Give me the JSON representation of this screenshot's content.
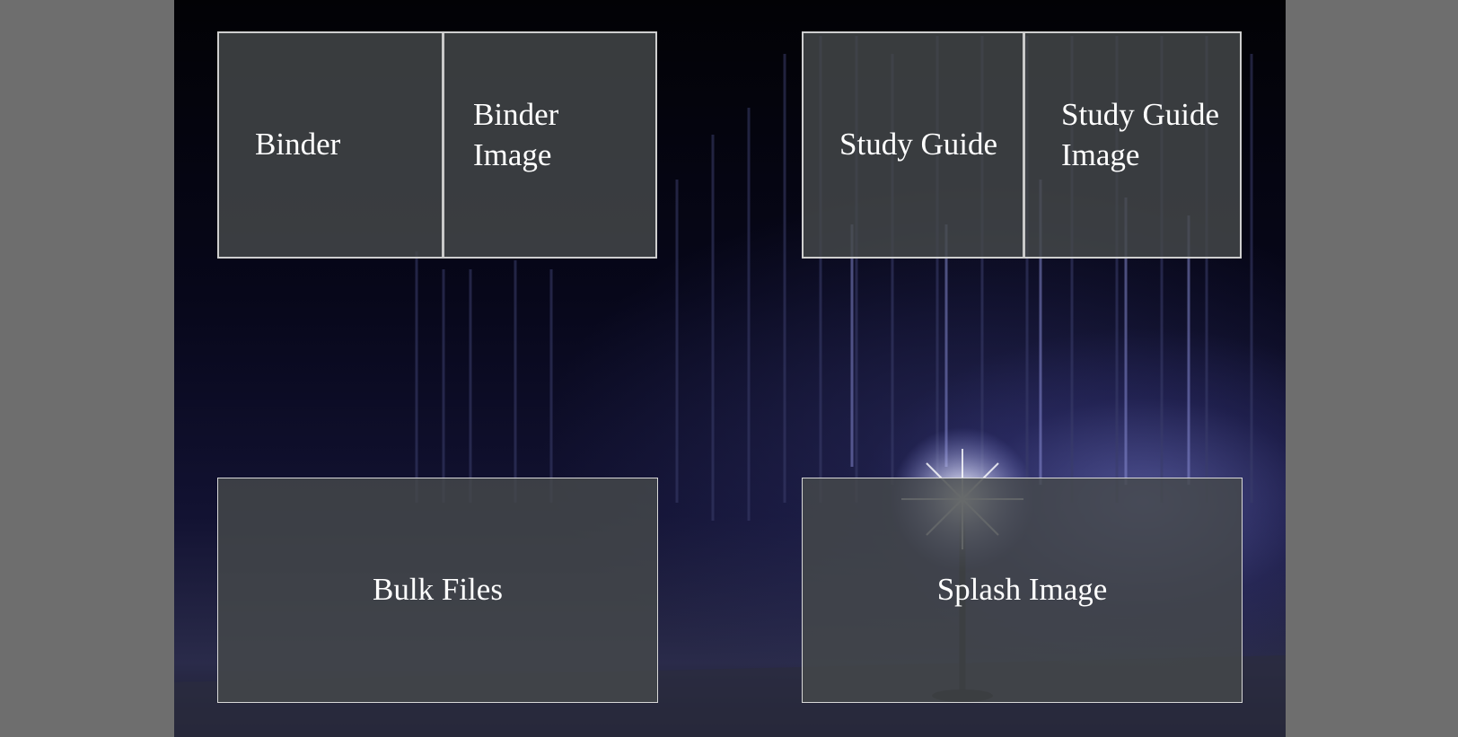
{
  "tiles": {
    "binder": "Binder",
    "binder_image": "Binder Image",
    "study_guide": "Study Guide",
    "study_guide_image": "Study Guide Image",
    "bulk_files": "Bulk Files",
    "splash_image": "Splash Image"
  },
  "background": {
    "description_icon": "theater-stage-photo",
    "accent": "#3c3f78"
  },
  "colors": {
    "page_bg": "#6e6e6e",
    "tile_bg": "#46494b",
    "tile_border": "#d8d8d8",
    "text": "#ffffff"
  }
}
